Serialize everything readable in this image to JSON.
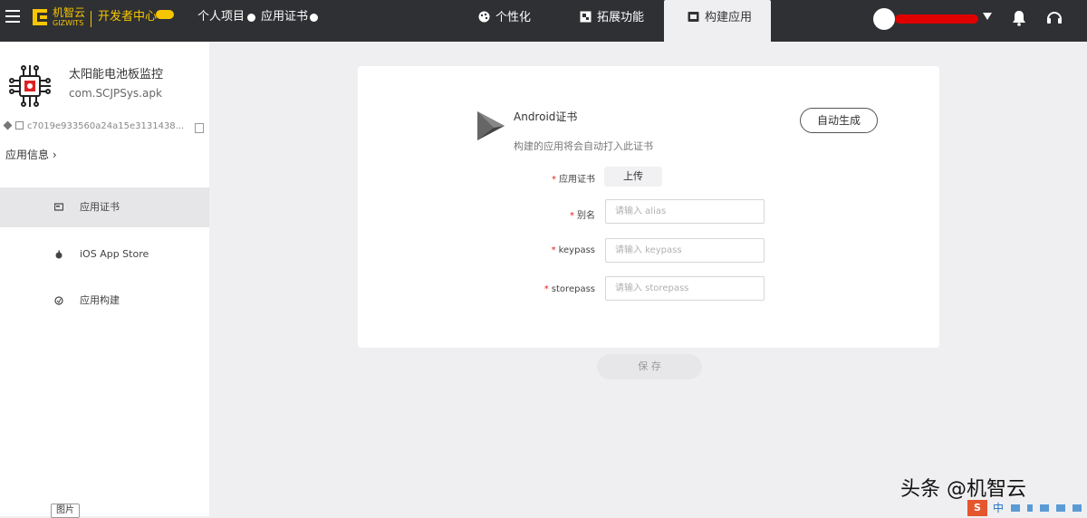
{
  "topbar": {
    "logo_text": "机智云",
    "logo_sub": "GIZWITS",
    "dev_center": "开发者中心",
    "nav_project": "个人项目",
    "nav_cert": "应用证书",
    "tabs": [
      {
        "label": "个性化",
        "icon": "palette-icon"
      },
      {
        "label": "拓展功能",
        "icon": "extension-icon"
      },
      {
        "label": "构建应用",
        "icon": "build-icon",
        "active": true
      }
    ],
    "accent_color": "#f7c600"
  },
  "sidebar": {
    "app_name": "太阳能电池板监控",
    "app_package": "com.SCJPSys.apk",
    "app_id": "c7019e933560a24a15e3131438...",
    "app_info_link": "应用信息 ›",
    "menu": [
      {
        "label": "应用证书",
        "icon": "certificate-icon",
        "active": true
      },
      {
        "label": "iOS App Store",
        "icon": "apple-icon",
        "active": false
      },
      {
        "label": "应用构建",
        "icon": "build-icon",
        "active": false
      }
    ],
    "bottom_tag": "图片"
  },
  "card": {
    "title": "Android证书",
    "description": "构建的应用将会自动打入此证书",
    "auto_generate_label": "自动生成",
    "fields": [
      {
        "label": "应用证书",
        "type": "upload",
        "button": "上传"
      },
      {
        "label": "别名",
        "type": "input",
        "placeholder": "请输入 alias"
      },
      {
        "label": "keypass",
        "type": "input",
        "placeholder": "请输入 keypass"
      },
      {
        "label": "storepass",
        "type": "input",
        "placeholder": "请输入 storepass"
      }
    ]
  },
  "save_label": "保 存",
  "watermark": "头条 @机智云",
  "tray": {
    "h5": "S",
    "zh": "中"
  }
}
